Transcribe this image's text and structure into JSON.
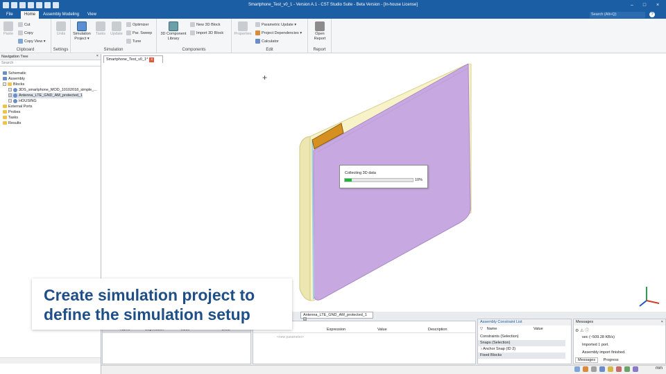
{
  "window": {
    "title": "Smartphone_Test_v0_1 - Version A.1 - CST Studio Suite - Beta Version - [In-house License]",
    "search_placeholder": "Search (Alt+Q)",
    "help": "?"
  },
  "menu_tabs": [
    "File",
    "Home",
    "Assembly Modeling",
    "View"
  ],
  "ribbon": {
    "clipboard": {
      "label": "Clipboard",
      "paste": "Paste",
      "cut": "Cut",
      "copy": "Copy",
      "copy_view": "Copy View"
    },
    "settings": {
      "label": "Settings",
      "units": "Units"
    },
    "simulation": {
      "label": "Simulation",
      "sim_project_line1": "Simulation",
      "sim_project_line2": "Project",
      "tasks": "Tasks",
      "update": "Update",
      "optimizer": "Optimizer",
      "par_sweep": "Par. Sweep",
      "tune": "Tune"
    },
    "components": {
      "label": "Components",
      "lib_line1": "3D Component",
      "lib_line2": "Library",
      "new_block": "New 3D Block",
      "import_block": "Import 3D Block"
    },
    "edit": {
      "label": "Edit",
      "properties": "Properties",
      "parametric_update": "Parametric Update",
      "project_dependencies": "Project Dependencies",
      "calculator": "Calculator"
    },
    "report": {
      "label": "Report",
      "open_line1": "Open",
      "open_line2": "Report"
    }
  },
  "nav_tree": {
    "title": "Navigation Tree",
    "search_placeholder": "Search",
    "items": [
      "Schematic",
      "Assembly",
      "Blocks",
      "3DS_smartphone_MOD_10102018_simple_...",
      "Antenna_LTE_GND_AM_protected_1",
      "HOUSING",
      "External Ports",
      "Probes",
      "Tasks",
      "Results"
    ]
  },
  "doc_tab": {
    "label": "Smartphone_Test_v0_1*",
    "close": "x"
  },
  "progress_dialog": {
    "text": "Collecting 3D data",
    "percent_label": "10%",
    "value": 0.1
  },
  "caption": {
    "line1": "Create simulation project to",
    "line2": "define the simulation setup"
  },
  "bottom": {
    "block_tab": "Antenna_LTE_GND_AM_protected_1",
    "left_params_headers": [
      "Name",
      "Expression",
      "Value",
      "Units"
    ],
    "params_headers": [
      "Expression",
      "Value",
      "Description"
    ],
    "new_parameter_placeholder": "<new parameter>",
    "constraints": {
      "title": "Assembly Constraint List",
      "headers": [
        "Name",
        "Value"
      ],
      "rows": [
        "Constraints (Selection)",
        "Snaps (Selection)",
        "Anchor Snap (ID 2)",
        "Fixed Blocks"
      ]
    },
    "messages": {
      "title": "Messages",
      "lines": [
        "sec (~509.28 KB/s)",
        "Imported 1 port.",
        "Assembly import finished."
      ],
      "tabs": [
        "Messages",
        "Progress"
      ]
    }
  },
  "statusbar": {
    "units": "mm"
  },
  "colors": {
    "accent": "#1c5ea3",
    "model_fill": "#c8a8e0",
    "caption_text": "#1f4f86",
    "progress": "#19b83a"
  }
}
